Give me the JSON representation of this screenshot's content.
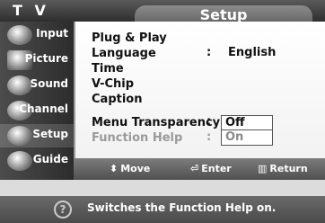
{
  "header": {
    "app_label": "T V",
    "title": "Setup"
  },
  "sidebar": {
    "items": [
      {
        "label": "Input",
        "icon": "input-icon"
      },
      {
        "label": "Picture",
        "icon": "picture-icon"
      },
      {
        "label": "Sound",
        "icon": "sound-icon"
      },
      {
        "label": "Channel",
        "icon": "channel-icon"
      },
      {
        "label": "Setup",
        "icon": "setup-icon",
        "active": true
      },
      {
        "label": "Guide",
        "icon": "guide-icon"
      }
    ]
  },
  "menu": {
    "items": [
      {
        "label": "Plug & Play"
      },
      {
        "label": "Language",
        "colon": ":",
        "value": "English"
      },
      {
        "label": "Time"
      },
      {
        "label": "V-Chip"
      },
      {
        "label": "Caption"
      },
      {
        "label": "Menu Transparency",
        "colon": ":"
      },
      {
        "label": "Function Help",
        "colon": ":",
        "dimmed": true
      }
    ],
    "dropdown_options": [
      "Off",
      "On"
    ]
  },
  "footer": {
    "move": "Move",
    "enter": "Enter",
    "return": "Return"
  },
  "help": {
    "icon_text": "?",
    "text": "Switches the Function Help on."
  }
}
